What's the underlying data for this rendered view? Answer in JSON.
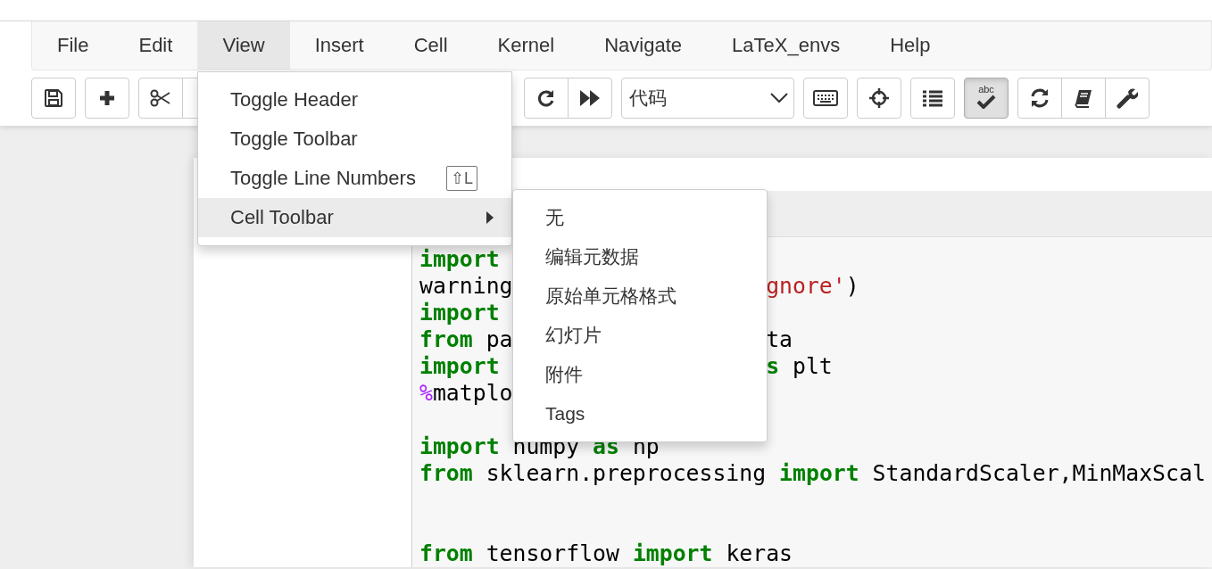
{
  "menubar": {
    "items": [
      {
        "label": "File",
        "selected": false
      },
      {
        "label": "Edit",
        "selected": false
      },
      {
        "label": "View",
        "selected": true
      },
      {
        "label": "Insert",
        "selected": false
      },
      {
        "label": "Cell",
        "selected": false
      },
      {
        "label": "Kernel",
        "selected": false
      },
      {
        "label": "Navigate",
        "selected": false
      },
      {
        "label": "LaTeX_envs",
        "selected": false
      },
      {
        "label": "Help",
        "selected": false
      }
    ]
  },
  "toolbar": {
    "groups": [
      {
        "buttons": [
          {
            "kind": "save",
            "pressed": false
          }
        ]
      },
      {
        "buttons": [
          {
            "kind": "add",
            "pressed": false
          }
        ]
      },
      {
        "buttons": [
          {
            "kind": "cut",
            "pressed": false
          },
          {
            "kind": "covered",
            "pressed": false
          }
        ]
      },
      {
        "buttons": [
          {
            "kind": "restart",
            "pressed": false
          },
          {
            "kind": "run-all",
            "pressed": false
          }
        ]
      },
      {
        "select": {
          "value": "代码"
        }
      },
      {
        "buttons": [
          {
            "kind": "keyboard",
            "pressed": false
          }
        ]
      },
      {
        "buttons": [
          {
            "kind": "crosshair",
            "pressed": false
          }
        ]
      },
      {
        "buttons": [
          {
            "kind": "list",
            "pressed": false
          }
        ]
      },
      {
        "buttons": [
          {
            "kind": "spellcheck",
            "label": "abc",
            "pressed": true
          }
        ]
      },
      {
        "buttons": [
          {
            "kind": "refresh",
            "pressed": false
          },
          {
            "kind": "book",
            "pressed": false
          },
          {
            "kind": "wrench",
            "pressed": false
          }
        ]
      }
    ]
  },
  "view_menu": {
    "items": [
      {
        "label": "Toggle Header",
        "highlighted": false
      },
      {
        "label": "Toggle Toolbar",
        "highlighted": false
      },
      {
        "label": "Toggle Line Numbers",
        "shortcut": "⇧L",
        "highlighted": false
      },
      {
        "label": "Cell Toolbar",
        "submenu": true,
        "highlighted": true
      }
    ]
  },
  "cell_toolbar_menu": {
    "items": [
      "无",
      "编辑元数据",
      "原始单元格格式",
      "幻灯片",
      "附件",
      "Tags"
    ]
  },
  "code_cell": {
    "lines": [
      {
        "kind": "code",
        "left": [
          {
            "text": "import",
            "kind": "keyword"
          }
        ]
      },
      {
        "kind": "code",
        "left": [
          {
            "text": "warning",
            "kind": "plain"
          }
        ],
        "right": [
          {
            "text": "gnore'",
            "kind": "string"
          },
          {
            "text": ")",
            "kind": "plain"
          }
        ]
      },
      {
        "kind": "code",
        "left": [
          {
            "text": "import",
            "kind": "keyword"
          }
        ]
      },
      {
        "kind": "code",
        "left": [
          {
            "text": "from",
            "kind": "keyword"
          },
          {
            "text": " pa",
            "kind": "plain"
          }
        ],
        "right": [
          {
            "text": "ta",
            "kind": "plain"
          }
        ]
      },
      {
        "kind": "code",
        "left": [
          {
            "text": "import",
            "kind": "keyword"
          }
        ],
        "right": [
          {
            "text": "s",
            "kind": "keyword"
          },
          {
            "text": " plt",
            "kind": "plain"
          }
        ]
      },
      {
        "kind": "code",
        "left": [
          {
            "text": "%",
            "kind": "magic"
          },
          {
            "text": "matplo",
            "kind": "plain"
          }
        ]
      },
      {
        "kind": "blank"
      },
      {
        "kind": "code",
        "left": [
          {
            "text": "import",
            "kind": "keyword"
          },
          {
            "text": " numpy ",
            "kind": "plain"
          },
          {
            "text": "as",
            "kind": "keyword"
          },
          {
            "text": " np",
            "kind": "plain"
          }
        ]
      },
      {
        "kind": "code",
        "left": [
          {
            "text": "from",
            "kind": "keyword"
          },
          {
            "text": " sklearn.preprocessing ",
            "kind": "plain"
          },
          {
            "text": "import",
            "kind": "keyword"
          },
          {
            "text": " StandardScaler,MinMaxScal",
            "kind": "plain"
          }
        ]
      },
      {
        "kind": "blank"
      },
      {
        "kind": "blank"
      },
      {
        "kind": "code",
        "left": [
          {
            "text": "from",
            "kind": "keyword"
          },
          {
            "text": " tensorflow ",
            "kind": "plain"
          },
          {
            "text": "import",
            "kind": "keyword"
          },
          {
            "text": " keras",
            "kind": "plain"
          }
        ]
      }
    ]
  }
}
